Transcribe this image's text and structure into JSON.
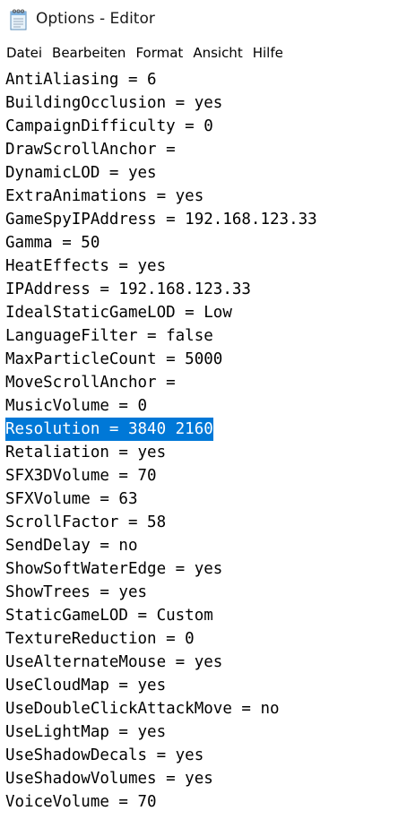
{
  "window": {
    "title": "Options - Editor",
    "icon": "notepad-icon"
  },
  "menu": [
    {
      "label": "Datei"
    },
    {
      "label": "Bearbeiten"
    },
    {
      "label": "Format"
    },
    {
      "label": "Ansicht"
    },
    {
      "label": "Hilfe"
    }
  ],
  "editor": {
    "selection_color": "#0078d7",
    "lines": [
      {
        "text": "AntiAliasing = 6",
        "selected": false
      },
      {
        "text": "BuildingOcclusion = yes",
        "selected": false
      },
      {
        "text": "CampaignDifficulty = 0",
        "selected": false
      },
      {
        "text": "DrawScrollAnchor =",
        "selected": false
      },
      {
        "text": "DynamicLOD = yes",
        "selected": false
      },
      {
        "text": "ExtraAnimations = yes",
        "selected": false
      },
      {
        "text": "GameSpyIPAddress = 192.168.123.33",
        "selected": false
      },
      {
        "text": "Gamma = 50",
        "selected": false
      },
      {
        "text": "HeatEffects = yes",
        "selected": false
      },
      {
        "text": "IPAddress = 192.168.123.33",
        "selected": false
      },
      {
        "text": "IdealStaticGameLOD = Low",
        "selected": false
      },
      {
        "text": "LanguageFilter = false",
        "selected": false
      },
      {
        "text": "MaxParticleCount = 5000",
        "selected": false
      },
      {
        "text": "MoveScrollAnchor =",
        "selected": false
      },
      {
        "text": "MusicVolume = 0",
        "selected": false
      },
      {
        "text": "Resolution = 3840 2160",
        "selected": true
      },
      {
        "text": "Retaliation = yes",
        "selected": false
      },
      {
        "text": "SFX3DVolume = 70",
        "selected": false
      },
      {
        "text": "SFXVolume = 63",
        "selected": false
      },
      {
        "text": "ScrollFactor = 58",
        "selected": false
      },
      {
        "text": "SendDelay = no",
        "selected": false
      },
      {
        "text": "ShowSoftWaterEdge = yes",
        "selected": false
      },
      {
        "text": "ShowTrees = yes",
        "selected": false
      },
      {
        "text": "StaticGameLOD = Custom",
        "selected": false
      },
      {
        "text": "TextureReduction = 0",
        "selected": false
      },
      {
        "text": "UseAlternateMouse = yes",
        "selected": false
      },
      {
        "text": "UseCloudMap = yes",
        "selected": false
      },
      {
        "text": "UseDoubleClickAttackMove = no",
        "selected": false
      },
      {
        "text": "UseLightMap = yes",
        "selected": false
      },
      {
        "text": "UseShadowDecals = yes",
        "selected": false
      },
      {
        "text": "UseShadowVolumes = yes",
        "selected": false
      },
      {
        "text": "VoiceVolume = 70",
        "selected": false
      }
    ]
  }
}
